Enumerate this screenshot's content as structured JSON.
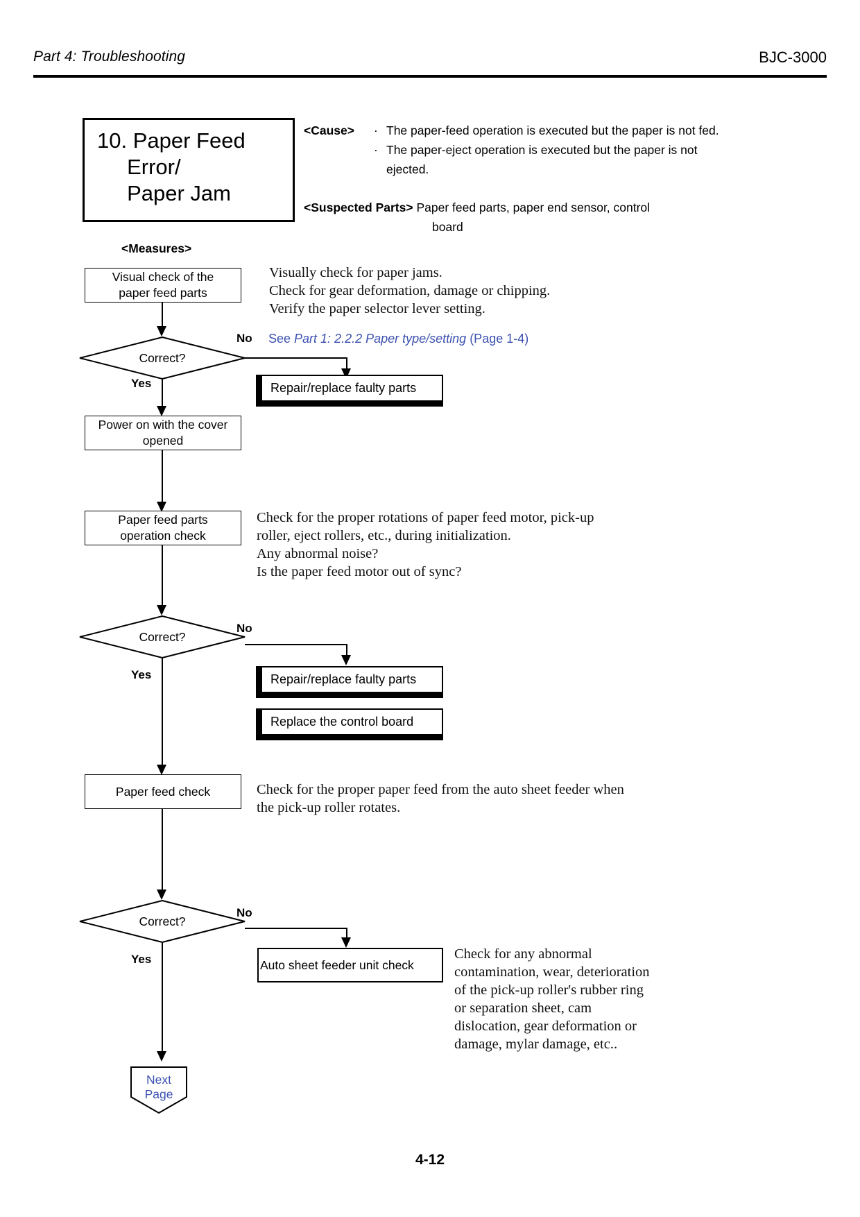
{
  "header": {
    "left_title": "Part 4: Troubleshooting",
    "right_title": "BJC-3000"
  },
  "title_box": {
    "text": "10. Paper Feed\n     Error/\n     Paper Jam"
  },
  "cause": {
    "label": "<Cause>",
    "items": [
      "The paper-feed operation is executed but the paper is not fed.",
      "The paper-eject operation is executed but the paper is not ejected."
    ],
    "bullet": "·"
  },
  "suspected_parts": {
    "label": "<Suspected Parts>",
    "value_line1": "Paper feed parts, paper end sensor, control",
    "value_line2": "board"
  },
  "measures": {
    "label": "<Measures>"
  },
  "flow": {
    "boxes": [
      {
        "id": "visual-check",
        "text": "Visual check of the\npaper feed parts"
      },
      {
        "id": "power-on",
        "text": "Power on with the cover\nopened"
      },
      {
        "id": "feed-parts-op",
        "text": "Paper feed parts\noperation check"
      },
      {
        "id": "paper-feed-check",
        "text": "Paper feed check"
      },
      {
        "id": "asf-unit-check",
        "text": "Auto sheet feeder unit check"
      }
    ],
    "decisions": [
      {
        "id": "decision-1",
        "text": "Correct?"
      },
      {
        "id": "decision-2",
        "text": "Correct?"
      },
      {
        "id": "decision-3",
        "text": "Correct?"
      }
    ],
    "shadow_boxes": [
      {
        "id": "repair-1",
        "text": "Repair/replace faulty parts"
      },
      {
        "id": "repair-2",
        "text": "Repair/replace faulty parts"
      },
      {
        "id": "replace-board",
        "text": "Replace the control board"
      }
    ],
    "branch_labels": {
      "yes": "Yes",
      "no": "No"
    },
    "next_page": "Next\nPage"
  },
  "descriptions": {
    "visual_check": [
      "Visually check for paper jams.",
      "Check for gear deformation, damage or chipping.",
      "Verify the paper selector lever setting."
    ],
    "operation_check": [
      "Check for the proper rotations of paper feed motor, pick-up",
      "roller, eject rollers, etc., during initialization.",
      "Any abnormal noise?",
      "Is the paper feed motor out of sync?"
    ],
    "paper_feed_check": [
      "Check for the proper paper feed from the auto sheet feeder when",
      "the pick-up roller rotates."
    ],
    "asf_check": [
      "Check for any abnormal",
      "contamination, wear, deterioration",
      "of the pick-up roller's rubber ring",
      "or separation sheet, cam",
      "dislocation, gear deformation or",
      "damage, mylar damage, etc.."
    ]
  },
  "reference": {
    "prefix": "See ",
    "italic": "Part 1: 2.2.2 Paper type/setting",
    "suffix": " (Page 1-4)"
  },
  "footer": {
    "page_number": "4-12"
  },
  "colors": {
    "link_blue": "#3b50b0",
    "ink": "#000000"
  }
}
